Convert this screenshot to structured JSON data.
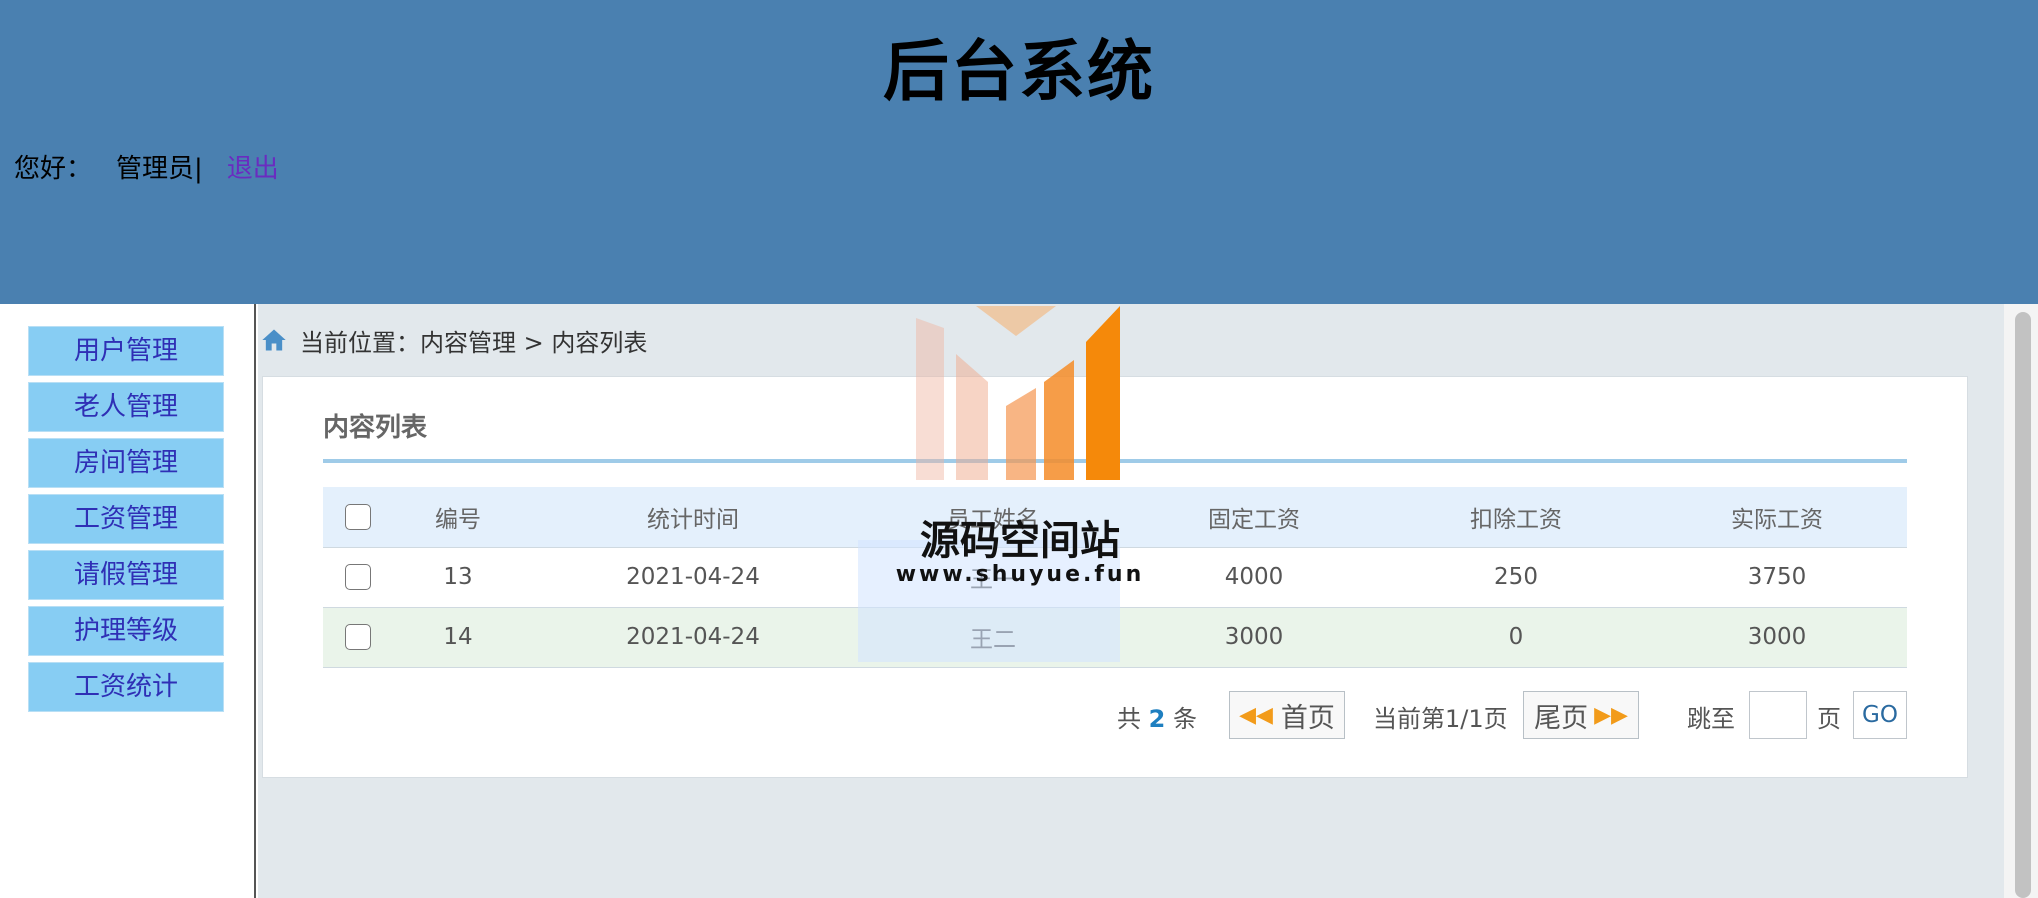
{
  "header": {
    "title": "后台系统",
    "greeting": "您好：",
    "user": "管理员|",
    "logout": "退出"
  },
  "sidebar": {
    "items": [
      {
        "label": "用户管理"
      },
      {
        "label": "老人管理"
      },
      {
        "label": "房间管理"
      },
      {
        "label": "工资管理"
      },
      {
        "label": "请假管理"
      },
      {
        "label": "护理等级"
      },
      {
        "label": "工资统计"
      }
    ]
  },
  "breadcrumb": {
    "text": "当前位置：内容管理 > 内容列表"
  },
  "panel": {
    "title": "内容列表"
  },
  "table": {
    "headers": [
      "编号",
      "统计时间",
      "员工姓名",
      "固定工资",
      "扣除工资",
      "实际工资"
    ],
    "rows": [
      {
        "id": "13",
        "date": "2021-04-24",
        "name": "王一",
        "fixed": "4000",
        "deduct": "250",
        "actual": "3750"
      },
      {
        "id": "14",
        "date": "2021-04-24",
        "name": "王二",
        "fixed": "3000",
        "deduct": "0",
        "actual": "3000"
      }
    ]
  },
  "pager": {
    "total_prefix": "共",
    "total_count": "2",
    "total_suffix": "条",
    "first_label": "首页",
    "current": "当前第1/1页",
    "last_label": "尾页",
    "jump_label": "跳至",
    "page_suffix": "页",
    "go_label": "GO",
    "page_input_value": ""
  },
  "watermark": {
    "name": "源码空间站",
    "url": "www.shuyue.fun"
  },
  "colors": {
    "header_bg": "#4a80b0",
    "nav_item_bg": "#87cdf3",
    "nav_item_text": "#2f2fb5",
    "logout_link": "#6a2cc0",
    "table_header_bg": "#e4f0fc",
    "row_even_bg": "#eaf4ea"
  },
  "icons": {
    "home": "home-icon",
    "first_arrows": "double-arrow-left-icon",
    "last_arrows": "double-arrow-right-icon"
  }
}
